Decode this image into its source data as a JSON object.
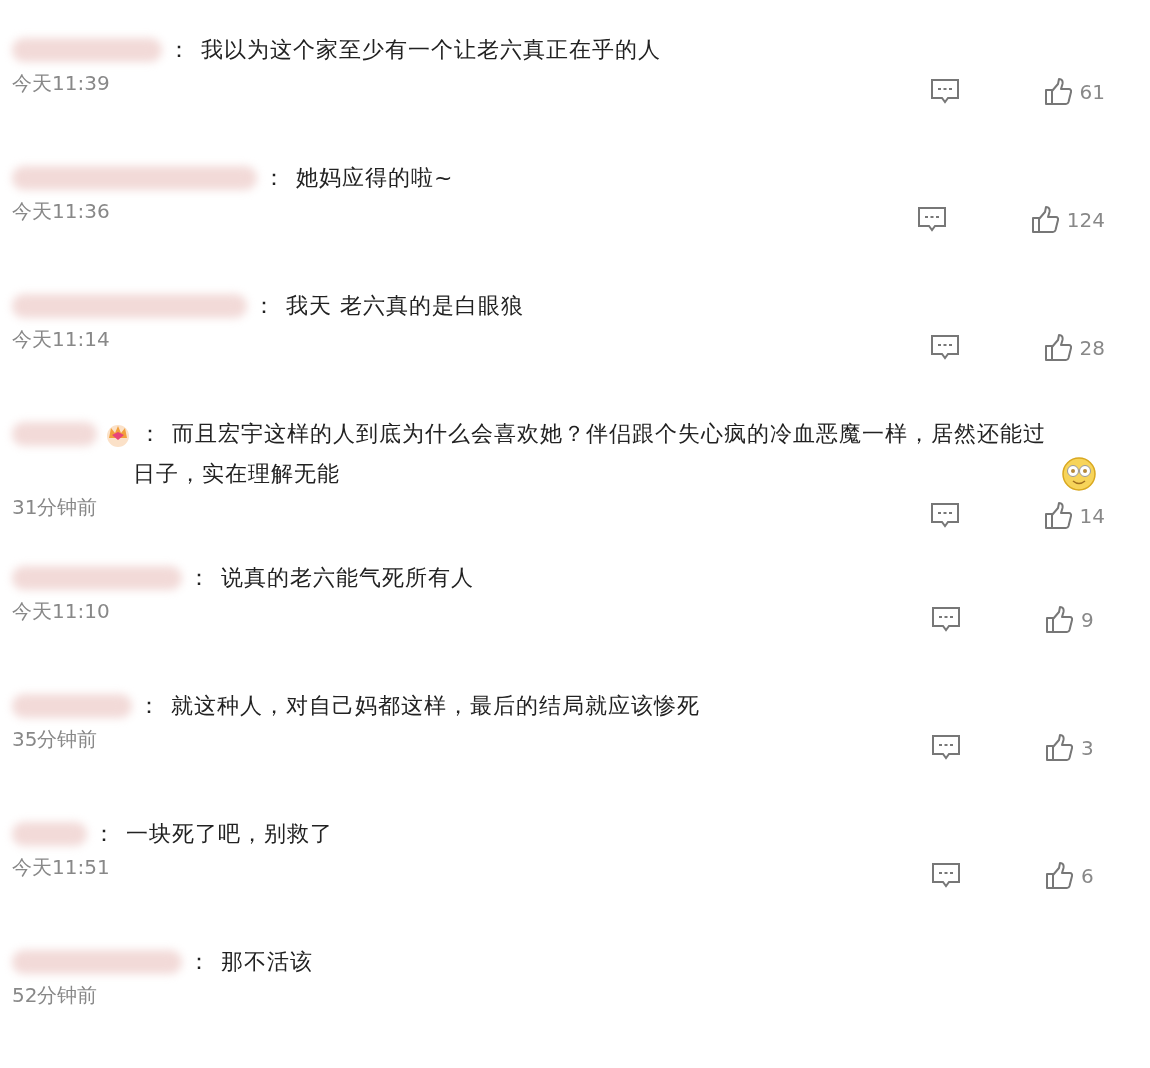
{
  "comments": [
    {
      "separator": "：",
      "text": "我以为这个家至少有一个让老六真正在乎的人",
      "has_badge": false,
      "trailing_emoji": false,
      "time": "今天11:39",
      "likes": "61"
    },
    {
      "separator": "：",
      "text": "她妈应得的啦~",
      "has_badge": false,
      "trailing_emoji": false,
      "time": "今天11:36",
      "likes": "124"
    },
    {
      "separator": "：",
      "text": "我天 老六真的是白眼狼",
      "has_badge": false,
      "trailing_emoji": false,
      "time": "今天11:14",
      "likes": "28"
    },
    {
      "separator": "：",
      "text": "而且宏宇这样的人到底为什么会喜欢她？伴侣跟个失心疯的冷血恶魔一样，居然还能过日子，实在理解无能",
      "has_badge": true,
      "trailing_emoji": true,
      "time": "31分钟前",
      "likes": "14"
    },
    {
      "separator": "：",
      "text": "说真的老六能气死所有人",
      "has_badge": false,
      "trailing_emoji": false,
      "time": "今天11:10",
      "likes": "9"
    },
    {
      "separator": "：",
      "text": "就这种人，对自己妈都这样，最后的结局就应该惨死",
      "has_badge": false,
      "trailing_emoji": false,
      "time": "35分钟前",
      "likes": "3"
    },
    {
      "separator": "：",
      "text": "一块死了吧，别救了",
      "has_badge": false,
      "trailing_emoji": false,
      "time": "今天11:51",
      "likes": "6"
    },
    {
      "separator": "：",
      "text": "那不活该",
      "has_badge": false,
      "trailing_emoji": false,
      "time": "52分钟前"
    }
  ]
}
